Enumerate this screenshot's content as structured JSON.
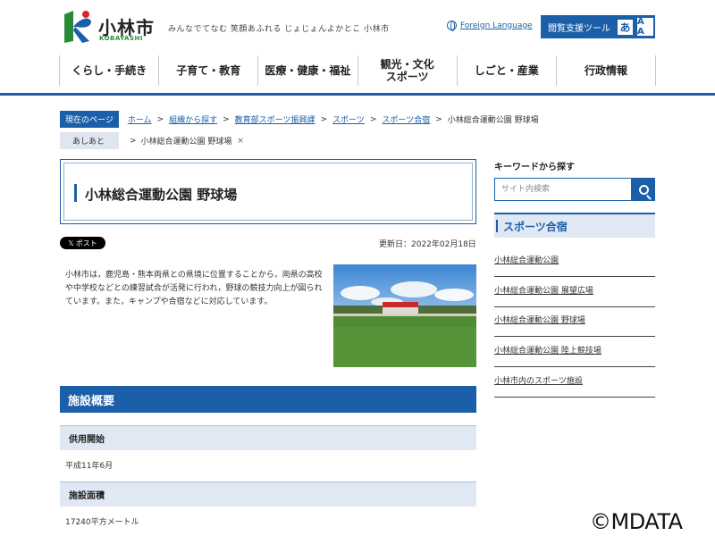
{
  "header": {
    "site_name": "小林市",
    "site_roman": "KOBAYASHI",
    "tagline": "みんなでてなむ 笑顔あふれる じょじょんよかとこ 小林市",
    "foreign_language": "Foreign Language",
    "tools_label": "閲覧支援ツール",
    "tools_icon1": "あ",
    "tools_icon2": "A A",
    "logo_icon": "city-logo"
  },
  "nav": {
    "items": [
      {
        "label": "くらし・手続き"
      },
      {
        "label": "子育て・教育"
      },
      {
        "label": "医療・健康・福祉"
      },
      {
        "label": "観光・文化 スポーツ"
      },
      {
        "label": "しごと・産業"
      },
      {
        "label": "行政情報"
      }
    ]
  },
  "breadcrumb": {
    "label": "現在のページ",
    "links": [
      "ホーム",
      "組織から探す",
      "教育部スポーツ振興課",
      "スポーツ",
      "スポーツ合宿"
    ],
    "current": "小林総合運動公園 野球場"
  },
  "trail": {
    "label": "あしあと",
    "item": "小林総合運動公園 野球場",
    "remove": "×"
  },
  "page": {
    "title": "小林総合運動公園 野球場",
    "post_label": "ポスト",
    "post_icon": "𝕏",
    "updated": "更新日：2022年02月18日",
    "intro": "小林市は，鹿児島・熊本両県との県境に位置することから，両県の高校や中学校などとの練習試合が活発に行われ，野球の競技力向上が図られています。また，キャンプや合宿などに対応しています。"
  },
  "facility": {
    "heading": "施設概要",
    "rows": [
      {
        "label": "供用開始",
        "value": "平成11年6月"
      },
      {
        "label": "施設面積",
        "value": "17240平方メートル"
      }
    ]
  },
  "sidebar": {
    "keyword_label": "キーワードから探す",
    "search_placeholder": "サイト内検索",
    "section_title": "スポーツ合宿",
    "links": [
      "小林総合運動公園",
      "小林総合運動公園 展望広場",
      "小林総合運動公園 野球場",
      "小林総合運動公園 陸上競技場",
      "小林市内のスポーツ施設"
    ]
  },
  "watermark": "©MDATA",
  "colors": {
    "primary": "#1a5fa8",
    "light_blue": "#dfe8f3",
    "logo_green": "#2a8a3a"
  }
}
